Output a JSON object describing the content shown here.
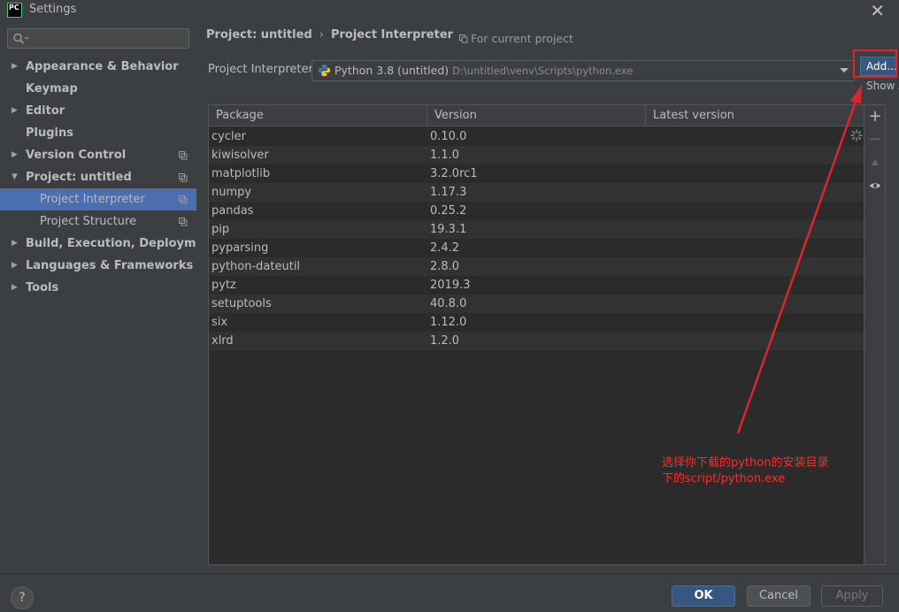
{
  "window": {
    "title": "Settings",
    "app_icon_text": "PC",
    "close_glyph": "✕"
  },
  "sidebar": {
    "search_placeholder": "",
    "items": [
      {
        "label": "Appearance & Behavior",
        "expandable": true,
        "bold": true
      },
      {
        "label": "Keymap",
        "expandable": false,
        "bold": true
      },
      {
        "label": "Editor",
        "expandable": true,
        "bold": true
      },
      {
        "label": "Plugins",
        "expandable": false,
        "bold": true
      },
      {
        "label": "Version Control",
        "expandable": true,
        "bold": true,
        "copy_icon": true
      },
      {
        "label": "Project: untitled",
        "expandable": true,
        "expanded": true,
        "bold": true,
        "copy_icon": true
      },
      {
        "label": "Project Interpreter",
        "child": true,
        "selected": true,
        "copy_icon": true
      },
      {
        "label": "Project Structure",
        "child": true,
        "copy_icon": true
      },
      {
        "label": "Build, Execution, Deployment",
        "expandable": true,
        "bold": true
      },
      {
        "label": "Languages & Frameworks",
        "expandable": true,
        "bold": true
      },
      {
        "label": "Tools",
        "expandable": true,
        "bold": true
      }
    ]
  },
  "breadcrumb": {
    "parent": "Project: untitled",
    "separator": "›",
    "current": "Project Interpreter",
    "scope_note": "For current project"
  },
  "interpreter": {
    "label": "Project Interpreter:",
    "name": "Python 3.8 (untitled)",
    "path": "D:\\untitled\\venv\\Scripts\\python.exe",
    "add_label": "Add...",
    "show_all_label": "Show All..."
  },
  "packages": {
    "columns": [
      "Package",
      "Version",
      "Latest version"
    ],
    "rows": [
      {
        "name": "cycler",
        "version": "0.10.0",
        "latest": ""
      },
      {
        "name": "kiwisolver",
        "version": "1.1.0",
        "latest": ""
      },
      {
        "name": "matplotlib",
        "version": "3.2.0rc1",
        "latest": ""
      },
      {
        "name": "numpy",
        "version": "1.17.3",
        "latest": ""
      },
      {
        "name": "pandas",
        "version": "0.25.2",
        "latest": ""
      },
      {
        "name": "pip",
        "version": "19.3.1",
        "latest": ""
      },
      {
        "name": "pyparsing",
        "version": "2.4.2",
        "latest": ""
      },
      {
        "name": "python-dateutil",
        "version": "2.8.0",
        "latest": ""
      },
      {
        "name": "pytz",
        "version": "2019.3",
        "latest": ""
      },
      {
        "name": "setuptools",
        "version": "40.8.0",
        "latest": ""
      },
      {
        "name": "six",
        "version": "1.12.0",
        "latest": ""
      },
      {
        "name": "xlrd",
        "version": "1.2.0",
        "latest": ""
      }
    ]
  },
  "tools": {
    "add": "+",
    "remove": "−",
    "upgrade": "▲",
    "show": "eye-icon"
  },
  "annotation": {
    "line1": "选择你下载的python的安装目录",
    "line2": "下的script/python.exe",
    "color": "#ff2b2b"
  },
  "footer": {
    "help": "?",
    "ok": "OK",
    "cancel": "Cancel",
    "apply": "Apply"
  },
  "colors": {
    "background": "#3c3f41",
    "selection": "#4b6eaf",
    "table_bg": "#2b2b2b",
    "primary_button": "#365880"
  }
}
